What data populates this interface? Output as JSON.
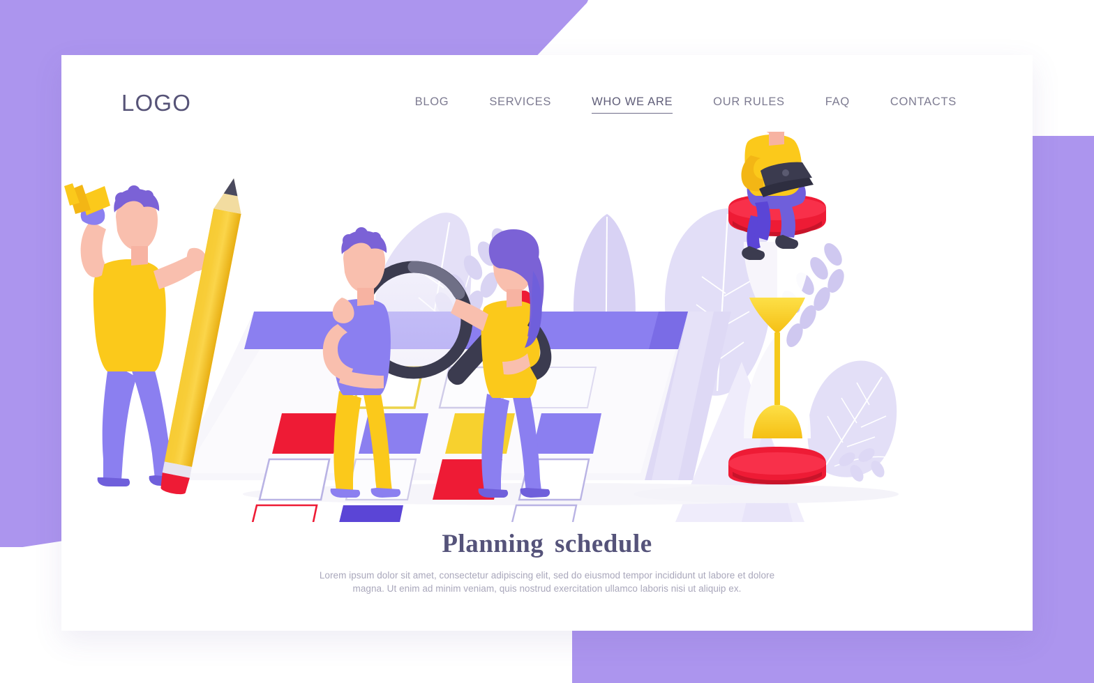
{
  "background": {
    "purple": "#ac95ee",
    "white": "#ffffff"
  },
  "card": {
    "background": "#ffffff"
  },
  "header": {
    "logo": "LOGO",
    "nav": [
      {
        "label": "BLOG",
        "active": false
      },
      {
        "label": "SERVICES",
        "active": false
      },
      {
        "label": "WHO WE ARE",
        "active": true
      },
      {
        "label": "OUR RULES",
        "active": false
      },
      {
        "label": "FAQ",
        "active": false
      },
      {
        "label": "CONTACTS",
        "active": false
      }
    ]
  },
  "caption": {
    "title": "Planning schedule",
    "subtitle": "Lorem ipsum dolor sit amet, consectetur adipiscing elit, sed do eiusmod tempor incididunt ut labore et dolore magna. Ut enim ad minim veniam, quis nostrud exercitation ullamco laboris nisi ut aliquip ex."
  },
  "illustration": {
    "name": "planning-schedule-illustration",
    "colors": {
      "purple": "#8b7ff0",
      "purple_dark": "#6f5fdb",
      "purple_deep": "#5b45d6",
      "red": "#ee1b35",
      "yellow": "#fbc91b",
      "yellow_light": "#f7d12e",
      "skin": "#f9bfae",
      "hair_purple": "#7b62d6",
      "charcoal": "#3b3b4f",
      "leaf_lavender": "#ddd9f6",
      "calendar_face": "#f6f5fb"
    },
    "elements": [
      {
        "name": "foliage-backdrop",
        "label": "decorative leaves"
      },
      {
        "name": "calendar-board",
        "label": "skewed calendar grid"
      },
      {
        "name": "calendar-header-bar",
        "label": "purple header row"
      },
      {
        "name": "magnifier",
        "label": "magnifying glass"
      },
      {
        "name": "person-with-megaphone-and-pencil",
        "label": "man holding megaphone and giant pencil"
      },
      {
        "name": "person-thinking",
        "label": "person in purple top thinking"
      },
      {
        "name": "person-with-magnifier",
        "label": "woman holding magnifying glass"
      },
      {
        "name": "person-on-hourglass-with-laptop",
        "label": "person sitting on hourglass with laptop"
      },
      {
        "name": "hourglass",
        "label": "red and yellow hourglass"
      }
    ]
  }
}
